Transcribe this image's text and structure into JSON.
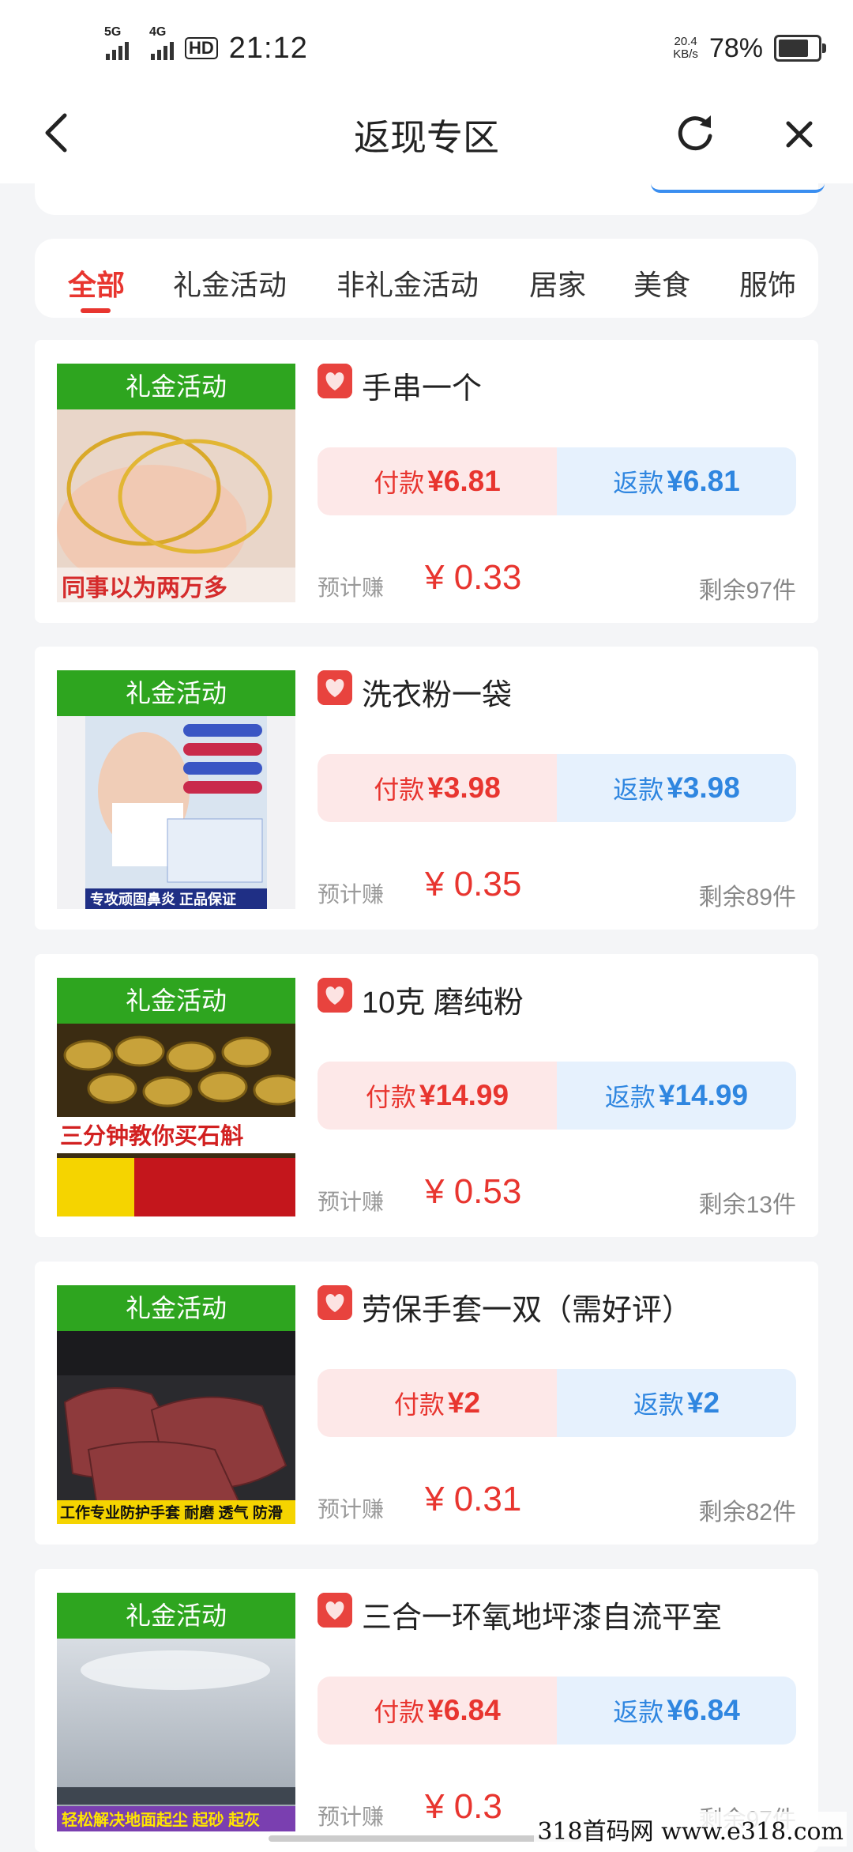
{
  "status_bar": {
    "sig1": "5G",
    "sig2": "4G",
    "hd": "HD",
    "time": "21:12",
    "net_speed_value": "20.4",
    "net_speed_unit": "KB/s",
    "battery": "78%",
    "battery_level": 0.78
  },
  "nav": {
    "title": "返现专区",
    "back_icon": "chevron-left-icon",
    "refresh_icon": "refresh-icon",
    "close_icon": "close-icon"
  },
  "tabs": [
    {
      "label": "全部"
    },
    {
      "label": "礼金活动"
    },
    {
      "label": "非礼金活动"
    },
    {
      "label": "居家"
    },
    {
      "label": "美食"
    },
    {
      "label": "服饰"
    }
  ],
  "cards": [
    {
      "badge": "礼金活动",
      "title": "手串一个",
      "pay_label": "付款",
      "pay_amount": "¥6.81",
      "return_label": "返款",
      "return_amount": "¥6.81",
      "earn_label": "预计赚",
      "earn_value": "¥ 0.33",
      "remain": "剩余97件",
      "art_caption": "同事以为两万多"
    },
    {
      "badge": "礼金活动",
      "title": "洗衣粉一袋",
      "pay_label": "付款",
      "pay_amount": "¥3.98",
      "return_label": "返款",
      "return_amount": "¥3.98",
      "earn_label": "预计赚",
      "earn_value": "¥ 0.35",
      "remain": "剩余89件",
      "art_caption": "专攻顽固鼻炎 正品保证"
    },
    {
      "badge": "礼金活动",
      "title": "10克 磨纯粉",
      "pay_label": "付款",
      "pay_amount": "¥14.99",
      "return_label": "返款",
      "return_amount": "¥14.99",
      "earn_label": "预计赚",
      "earn_value": "¥ 0.53",
      "remain": "剩余13件",
      "art_caption": "三分钟教你买石斛"
    },
    {
      "badge": "礼金活动",
      "title": "劳保手套一双（需好评）",
      "pay_label": "付款",
      "pay_amount": "¥2",
      "return_label": "返款",
      "return_amount": "¥2",
      "earn_label": "预计赚",
      "earn_value": "¥ 0.31",
      "remain": "剩余82件",
      "art_caption": "工作专业防护手套 耐磨 透气 防滑"
    },
    {
      "badge": "礼金活动",
      "title": "三合一环氧地坪漆自流平室",
      "pay_label": "付款",
      "pay_amount": "¥6.84",
      "return_label": "返款",
      "return_amount": "¥6.84",
      "earn_label": "预计赚",
      "earn_value": "¥ 0.3",
      "remain": "剩余97件",
      "art_caption": "轻松解决地面起尘 起砂 起灰"
    }
  ],
  "watermark": "318首码网 www.e318.com",
  "colors": {
    "accent": "#e8352f",
    "return_blue": "#2f86e0",
    "badge_green": "#2ea51f"
  }
}
